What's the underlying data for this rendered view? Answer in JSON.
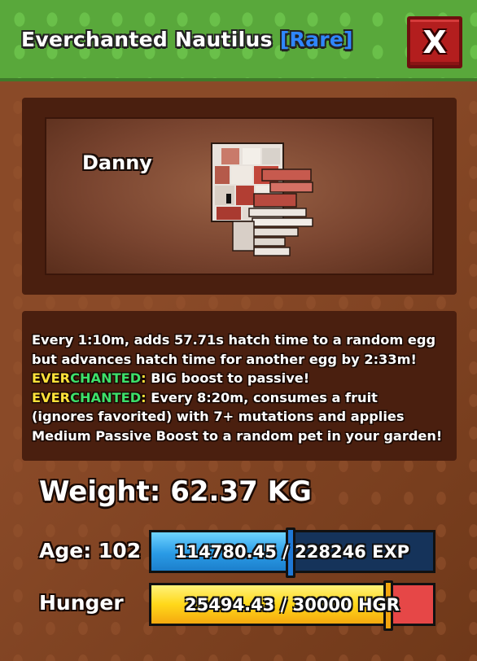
{
  "header": {
    "title": "Everchanted Nautilus",
    "rarity": "[Rare]",
    "close_label": "X"
  },
  "pet": {
    "name": "Danny",
    "model_icon": "nautilus-pet-model"
  },
  "description": {
    "line1": "Every 1:10m, adds 57.71s hatch time to a random egg",
    "line2": "but advances hatch time for another egg by 2:33m!",
    "line3_prefix_a": "EVER",
    "line3_prefix_b": "CHANTED",
    "line3_colon": ":",
    "line3_text": " BIG boost to passive!",
    "line4_prefix_a": "EVER",
    "line4_prefix_b": "CHANTED",
    "line4_colon": ":",
    "line4_text": " Every 8:20m, consumes a fruit",
    "line5": "(ignores favorited) with 7+ mutations and applies",
    "line6": "Medium Passive Boost to a random pet in your garden!"
  },
  "stats": {
    "weight_text": "Weight: 62.37 KG",
    "age_text": "Age: 102",
    "exp": {
      "current": 114780.45,
      "max": 228246,
      "text": "114780.45 / 228246 EXP",
      "fill_fraction": 0.503
    },
    "hunger_label": "Hunger",
    "hunger": {
      "current": 25494.43,
      "max": 30000,
      "text": "25494.43 / 30000 HGR",
      "fill_fraction": 0.85
    }
  },
  "colors": {
    "header_green": "#59a83b",
    "wood_brown": "#7a3f22",
    "panel_dark": "#4a1f0f",
    "rarity_blue": "#2f86ff",
    "ever_yellow": "#ffe23a",
    "chanted_green": "#3de06a",
    "close_red": "#b31e1e",
    "exp_blue": "#2a9be6",
    "hunger_yellow": "#ffd81a",
    "hunger_empty_red": "#e64747"
  }
}
